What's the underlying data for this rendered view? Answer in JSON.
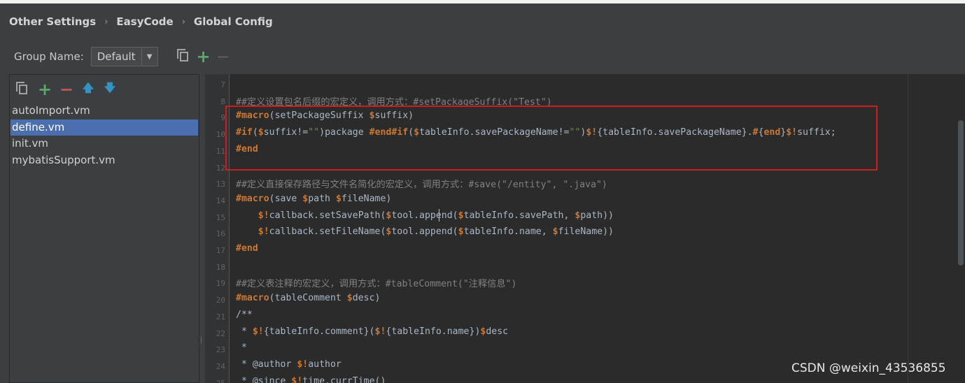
{
  "breadcrumb": [
    "Other Settings",
    "EasyCode",
    "Global Config"
  ],
  "group": {
    "label": "Group Name:",
    "value": "Default"
  },
  "files": [
    {
      "name": "autoImport.vm",
      "selected": false
    },
    {
      "name": "define.vm",
      "selected": true
    },
    {
      "name": "init.vm",
      "selected": false
    },
    {
      "name": "mybatisSupport.vm",
      "selected": false
    }
  ],
  "line_numbers": [
    "7",
    "8",
    "9",
    "10",
    "11",
    "12",
    "13",
    "14",
    "15",
    "16",
    "17",
    "18",
    "19",
    "20",
    "21",
    "22",
    "23",
    "24",
    "25"
  ],
  "code_lines": [
    [],
    [
      [
        "cm",
        "##定义设置包名后缀的宏定义，调用方式：#setPackageSuffix(\"Test\")"
      ]
    ],
    [
      [
        "kw",
        "#macro"
      ],
      [
        "id",
        "(setPackageSuffix "
      ],
      [
        "kw",
        "$"
      ],
      [
        "id",
        "suffix)"
      ]
    ],
    [
      [
        "kw",
        "#if"
      ],
      [
        "id",
        "("
      ],
      [
        "kw",
        "$"
      ],
      [
        "id",
        "suffix!="
      ],
      [
        "st",
        "\"\""
      ],
      [
        "id",
        ")package "
      ],
      [
        "kw",
        "#end#if"
      ],
      [
        "id",
        "("
      ],
      [
        "kw",
        "$"
      ],
      [
        "id",
        "tableInfo.savePackageName!="
      ],
      [
        "st",
        "\"\""
      ],
      [
        "id",
        ")"
      ],
      [
        "kw",
        "$!"
      ],
      [
        "id",
        "{tableInfo.savePackageName}."
      ],
      [
        "kw",
        "#"
      ],
      [
        "id",
        "{"
      ],
      [
        "kw",
        "end"
      ],
      [
        "id",
        "}"
      ],
      [
        "kw",
        "$!"
      ],
      [
        "id",
        "suffix;"
      ]
    ],
    [
      [
        "kw",
        "#end"
      ]
    ],
    [],
    [
      [
        "cm",
        "##定义直接保存路径与文件名简化的宏定义，调用方式：#save(\"/entity\", \".java\")"
      ]
    ],
    [
      [
        "kw",
        "#macro"
      ],
      [
        "id",
        "(save "
      ],
      [
        "kw",
        "$"
      ],
      [
        "id",
        "path "
      ],
      [
        "kw",
        "$"
      ],
      [
        "id",
        "fileName)"
      ]
    ],
    [
      [
        "id",
        "    "
      ],
      [
        "kw",
        "$!"
      ],
      [
        "id",
        "callback.setSavePath("
      ],
      [
        "kw",
        "$"
      ],
      [
        "id",
        "tool.append("
      ],
      [
        "kw",
        "$"
      ],
      [
        "id",
        "tableInfo.savePath, "
      ],
      [
        "kw",
        "$"
      ],
      [
        "id",
        "path))"
      ]
    ],
    [
      [
        "id",
        "    "
      ],
      [
        "kw",
        "$!"
      ],
      [
        "id",
        "callback.setFileName("
      ],
      [
        "kw",
        "$"
      ],
      [
        "id",
        "tool.append("
      ],
      [
        "kw",
        "$"
      ],
      [
        "id",
        "tableInfo.name, "
      ],
      [
        "kw",
        "$"
      ],
      [
        "id",
        "fileName))"
      ]
    ],
    [
      [
        "kw",
        "#end"
      ]
    ],
    [],
    [
      [
        "cm",
        "##定义表注释的宏定义，调用方式：#tableComment(\"注释信息\")"
      ]
    ],
    [
      [
        "kw",
        "#macro"
      ],
      [
        "id",
        "(tableComment "
      ],
      [
        "kw",
        "$"
      ],
      [
        "id",
        "desc)"
      ]
    ],
    [
      [
        "id",
        "/**"
      ]
    ],
    [
      [
        "id",
        " * "
      ],
      [
        "kw",
        "$!"
      ],
      [
        "id",
        "{tableInfo.comment}("
      ],
      [
        "kw",
        "$!"
      ],
      [
        "id",
        "{tableInfo.name})"
      ],
      [
        "kw",
        "$"
      ],
      [
        "id",
        "desc"
      ]
    ],
    [
      [
        "id",
        " *"
      ]
    ],
    [
      [
        "id",
        " * @author "
      ],
      [
        "kw",
        "$!"
      ],
      [
        "id",
        "author"
      ]
    ],
    [
      [
        "id",
        " * @since "
      ],
      [
        "kw",
        "$!"
      ],
      [
        "id",
        "time.currTime()"
      ]
    ]
  ],
  "watermark": "CSDN @weixin_43536855",
  "colors": {
    "keyword": "#cc7832",
    "comment": "#808080",
    "string": "#6a8759",
    "identifier": "#a9b7c6",
    "selection": "#4b6eaf",
    "highlight_box": "#d01c1c"
  },
  "icons": {
    "group_toolbar": [
      "copy-icon",
      "add-icon",
      "remove-icon"
    ],
    "file_toolbar": [
      "copy-icon",
      "add-icon",
      "remove-icon",
      "move-up-icon",
      "move-down-icon"
    ]
  }
}
